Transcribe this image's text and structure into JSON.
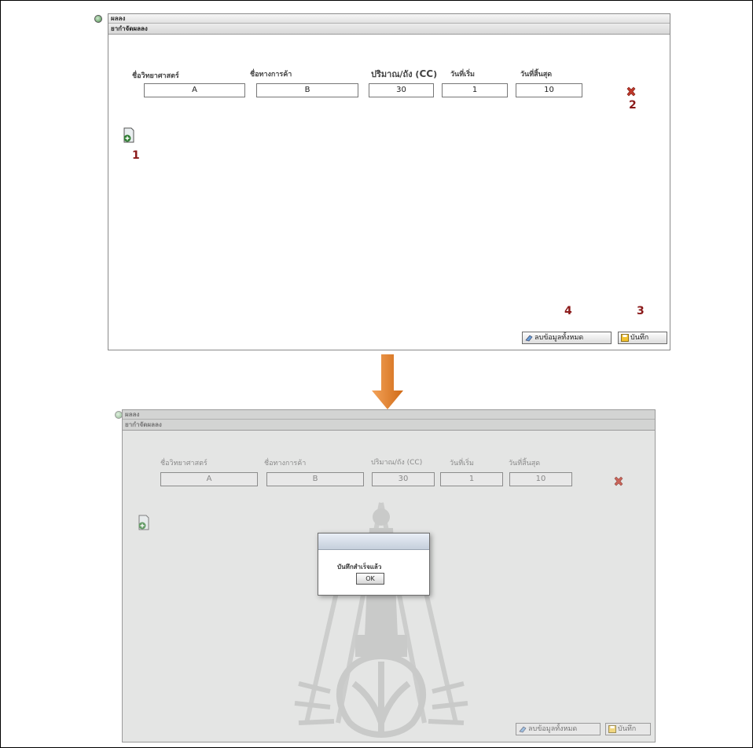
{
  "top": {
    "window_title": "ผลลง",
    "section_title": "ยากำจัดผลลง",
    "headers": [
      "ชื่อวิทยาศาสตร์",
      "ชื่อทางการค้า",
      "ปริมาณ/ถัง (",
      "CC",
      ")",
      "วันที่เริ่ม",
      "วันที่สิ้นสุด"
    ],
    "values": [
      "A",
      "B",
      "30",
      "1",
      "10"
    ],
    "markers": {
      "add": "1",
      "remove": "2",
      "save": "3",
      "clear": "4"
    },
    "buttons": {
      "clear": "ลบข้อมูลทั้งหมด",
      "save": "บันทึก"
    }
  },
  "bottom": {
    "window_title": "ผลลง",
    "section_title": "ยากำจัดผลลง",
    "headers": [
      "ชื่อวิทยาศาสตร์",
      "ชื่อทางการค้า",
      "ปริมาณ/ถัง (CC)",
      "วันที่เริ่ม",
      "วันที่สิ้นสุด"
    ],
    "values": [
      "A",
      "B",
      "30",
      "1",
      "10"
    ],
    "buttons": {
      "clear": "ลบข้อมูลทั้งหมด",
      "save": "บันทึก"
    },
    "dialog": {
      "message": "บันทึกสำเร็จแล้ว",
      "ok_label": "OK"
    }
  },
  "colors": {
    "marker": "#8b1a1a",
    "arrow": "#e8832a",
    "remove_icon": "#c0392b"
  }
}
